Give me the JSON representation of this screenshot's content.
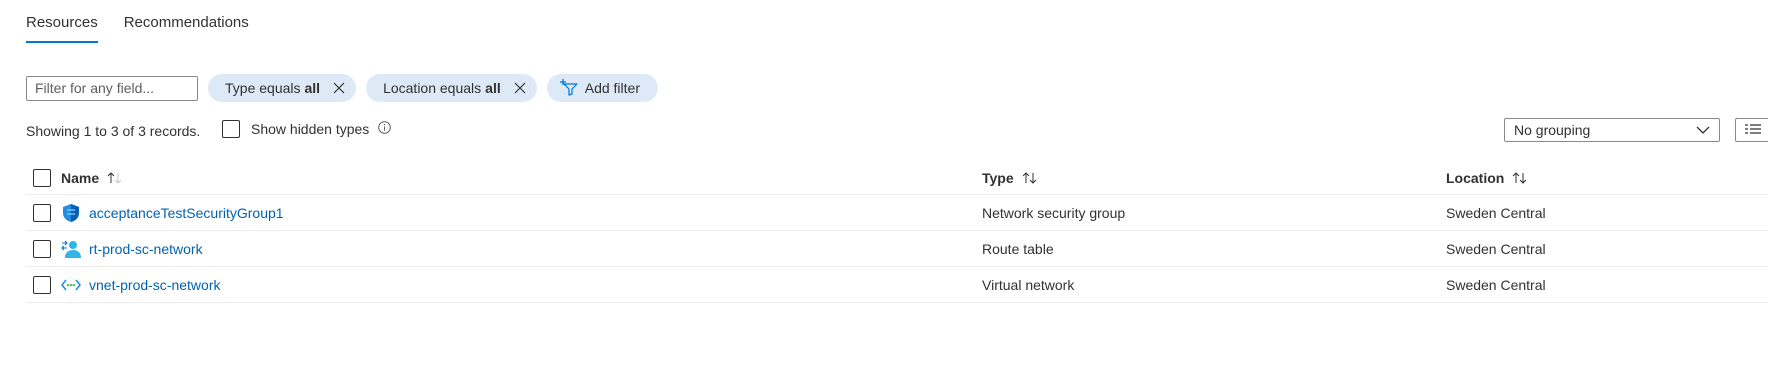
{
  "tabs": [
    {
      "label": "Resources",
      "active": true
    },
    {
      "label": "Recommendations",
      "active": false
    }
  ],
  "filter": {
    "placeholder": "Filter for any field...",
    "pills": [
      {
        "prefix": "Type equals",
        "value": "all"
      },
      {
        "prefix": "Location equals",
        "value": "all"
      }
    ],
    "add_filter_label": "Add filter"
  },
  "records_text": "Showing 1 to 3 of 3 records.",
  "show_hidden_label": "Show hidden types",
  "grouping": {
    "selected": "No grouping"
  },
  "table": {
    "headers": {
      "name": "Name",
      "type": "Type",
      "location": "Location"
    },
    "rows": [
      {
        "name": "acceptanceTestSecurityGroup1",
        "type": "Network security group",
        "location": "Sweden Central",
        "icon": "network-security-group-icon"
      },
      {
        "name": "rt-prod-sc-network",
        "type": "Route table",
        "location": "Sweden Central",
        "icon": "route-table-icon"
      },
      {
        "name": "vnet-prod-sc-network",
        "type": "Virtual network",
        "location": "Sweden Central",
        "icon": "virtual-network-icon"
      }
    ]
  },
  "colors": {
    "accent": "#0078d4",
    "link": "#0063b1",
    "pill_bg": "#dde9f7"
  }
}
